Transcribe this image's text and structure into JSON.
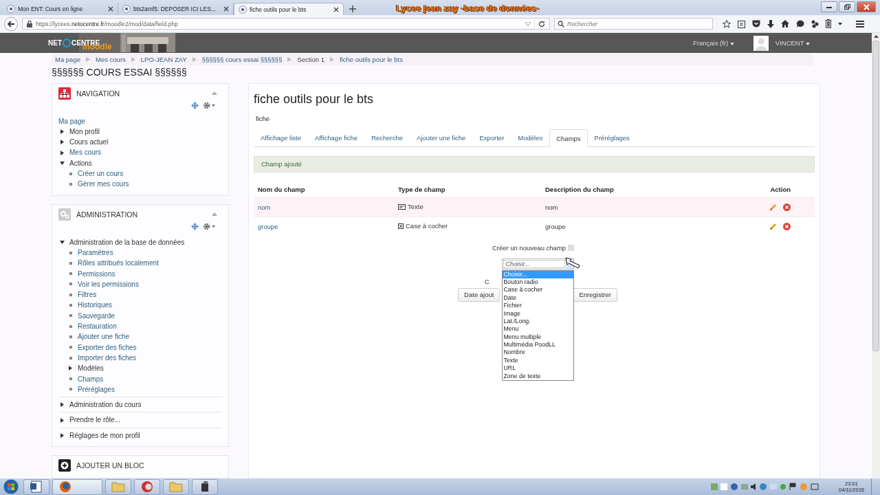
{
  "browser": {
    "tabs": [
      {
        "label": "Mon ENT: Cours en ligne",
        "selected": false
      },
      {
        "label": "bts2amf5: DEPOSER ICI LES...",
        "selected": false
      },
      {
        "label": "fiche outils pour le bts",
        "selected": true
      }
    ],
    "overlay_title": "Lycee jean zay -base de données-",
    "url_prefix": "https://lycees.",
    "url_domain": "netocentre.fr",
    "url_path": "/moodle2/mod/data/field.php",
    "search_placeholder": "Rechercher"
  },
  "header": {
    "logo_left": "NET",
    "logo_right": "CENTRE",
    "logo_sub": "moodle",
    "language": "Français (fr)",
    "user": "VINCENT"
  },
  "breadcrumb": [
    {
      "label": "Ma page",
      "link": true
    },
    {
      "label": "Mes cours",
      "link": true
    },
    {
      "label": "LPO-JEAN ZAY",
      "link": true
    },
    {
      "label": "§§§§§§ cours essai §§§§§§",
      "link": true
    },
    {
      "label": "Section 1",
      "link": false
    },
    {
      "label": "fiche outils pour le bts",
      "link": true
    }
  ],
  "course_title": "§§§§§§ COURS ESSAI §§§§§§",
  "blocks": [
    {
      "title": "NAVIGATION",
      "kind": "navigation",
      "items": [
        {
          "label": "Ma page",
          "kind": "link"
        },
        {
          "label": "Mon profil",
          "kind": "node",
          "expanded": false,
          "link": false
        },
        {
          "label": "Cours actuel",
          "kind": "node",
          "expanded": false,
          "link": false
        },
        {
          "label": "Mes cours",
          "kind": "node",
          "expanded": false,
          "link": true
        },
        {
          "label": "Actions",
          "kind": "node",
          "expanded": true,
          "link": false,
          "children": [
            {
              "label": "Créer un cours",
              "kind": "leaf"
            },
            {
              "label": "Gérer mes cours",
              "kind": "leaf"
            }
          ]
        }
      ]
    },
    {
      "title": "ADMINISTRATION",
      "kind": "administration",
      "dividers": true,
      "items": [
        {
          "label": "Administration de la base de données",
          "kind": "node",
          "expanded": true,
          "link": false,
          "children": [
            {
              "label": "Paramètres",
              "kind": "leaf"
            },
            {
              "label": "Rôles attribués localement",
              "kind": "leaf"
            },
            {
              "label": "Permissions",
              "kind": "leaf"
            },
            {
              "label": "Voir les permissions",
              "kind": "leaf"
            },
            {
              "label": "Filtres",
              "kind": "leaf"
            },
            {
              "label": "Historiques",
              "kind": "leaf"
            },
            {
              "label": "Sauvegarde",
              "kind": "leaf"
            },
            {
              "label": "Restauration",
              "kind": "leaf"
            },
            {
              "label": "Ajouter une fiche",
              "kind": "leaf"
            },
            {
              "label": "Exporter des fiches",
              "kind": "leaf"
            },
            {
              "label": "Importer des fiches",
              "kind": "leaf"
            },
            {
              "label": "Modèles",
              "kind": "node",
              "expanded": false,
              "link": false
            },
            {
              "label": "Champs",
              "kind": "leaf"
            },
            {
              "label": "Préréglages",
              "kind": "leaf"
            }
          ]
        },
        {
          "label": "Administration du cours",
          "kind": "node",
          "expanded": false,
          "link": false
        },
        {
          "label": "Prendre le rôle...",
          "kind": "node",
          "expanded": false,
          "link": false
        },
        {
          "label": "Réglages de mon profil",
          "kind": "node",
          "expanded": false,
          "link": false
        }
      ]
    },
    {
      "title": "AJOUTER UN BLOC",
      "kind": "add"
    }
  ],
  "main": {
    "title": "fiche outils pour le bts",
    "subtitle": "fiche",
    "tabs": [
      {
        "label": "Affichage liste",
        "selected": false
      },
      {
        "label": "Affichage fiche",
        "selected": false
      },
      {
        "label": "Recherche",
        "selected": false
      },
      {
        "label": "Ajouter une fiche",
        "selected": false
      },
      {
        "label": "Exporter",
        "selected": false
      },
      {
        "label": "Modèles",
        "selected": false
      },
      {
        "label": "Champs",
        "selected": true
      },
      {
        "label": "Préréglages",
        "selected": false
      }
    ],
    "notice": "Champ ajouté",
    "table": {
      "columns": [
        "Nom du champ",
        "Type de champ",
        "Description du champ",
        "Action"
      ],
      "rows": [
        {
          "name": "nom",
          "type": "Texte",
          "kind": "text",
          "description": "nom"
        },
        {
          "name": "groupe",
          "type": "Case à cocher",
          "kind": "checkbox",
          "description": "groupe"
        }
      ]
    },
    "create_label": "Créer un nouveau champ",
    "select": {
      "value": "Choisir...",
      "options": [
        {
          "label": "Choisir...",
          "selected": true
        },
        {
          "label": "Bouton radio",
          "selected": false
        },
        {
          "label": "Case à cocher",
          "selected": false
        },
        {
          "label": "Date",
          "selected": false
        },
        {
          "label": "Fichier",
          "selected": false
        },
        {
          "label": "Image",
          "selected": false
        },
        {
          "label": "Lat./Long.",
          "selected": false
        },
        {
          "label": "Menu",
          "selected": false
        },
        {
          "label": "Menu multiple",
          "selected": false
        },
        {
          "label": "Multimédia PoodLL",
          "selected": false
        },
        {
          "label": "Nombre",
          "selected": false
        },
        {
          "label": "Texte",
          "selected": false
        },
        {
          "label": "URL",
          "selected": false
        },
        {
          "label": "Zone de texte",
          "selected": false
        }
      ]
    },
    "hidden_label": "C",
    "buttons": [
      "Date ajout",
      "Enregistrer"
    ]
  },
  "taskbar": {
    "time": "23:01",
    "date": "04/11/2015"
  }
}
